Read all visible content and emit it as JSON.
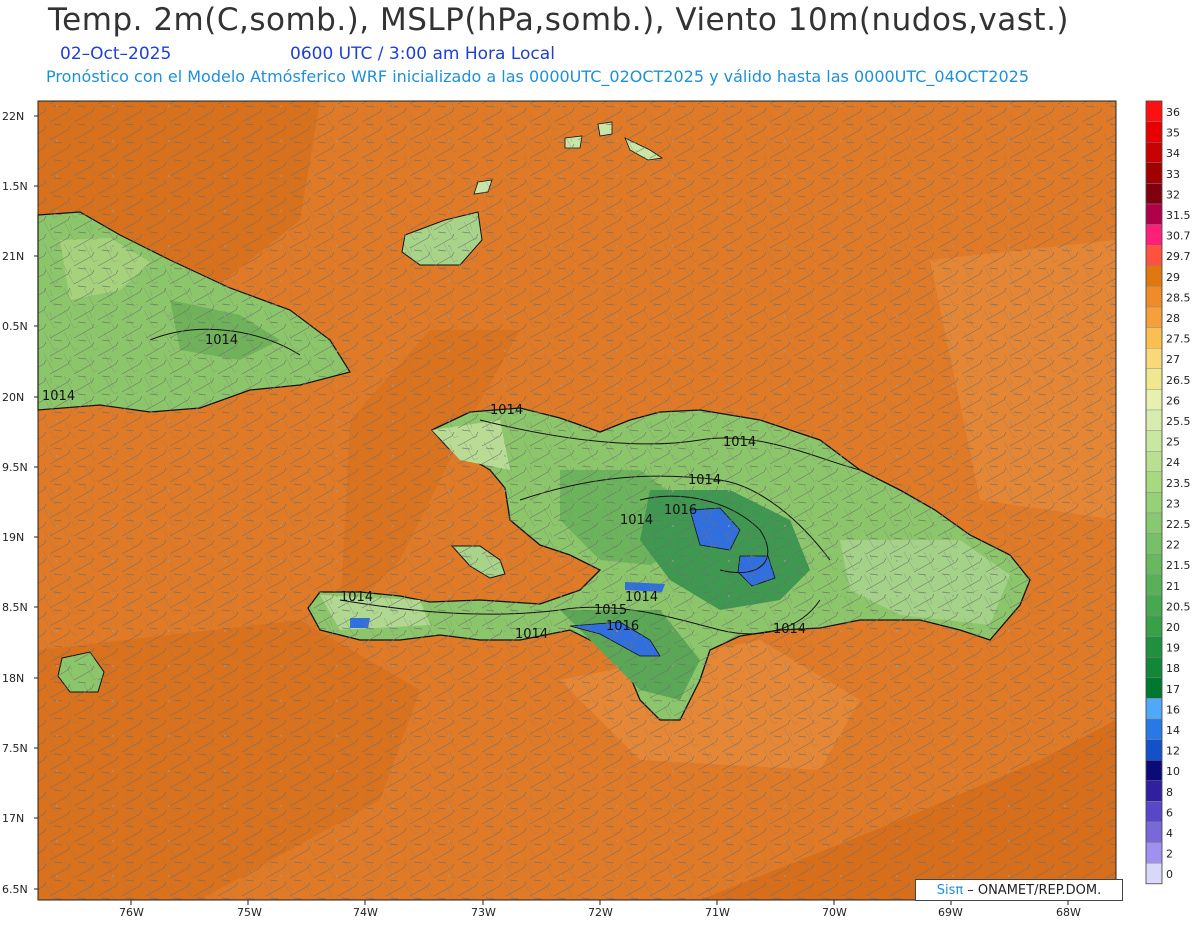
{
  "title": "Temp. 2m(C,somb.), MSLP(hPa,somb.), Viento 10m(nudos,vast.)",
  "date": "02–Oct–2025",
  "time": "0600 UTC / 3:00 am Hora Local",
  "subtitle": "Pronóstico con el Modelo Atmósferico WRF inicializado a las 0000UTC_02OCT2025 y válido hasta las  0000UTC_04OCT2025",
  "credit": {
    "brand": "Sisπ",
    "text": "– ONAMET/REP.DOM."
  },
  "lat_labels": [
    "22N",
    "1.5N",
    "21N",
    "0.5N",
    "20N",
    "9.5N",
    "19N",
    "8.5N",
    "18N",
    "7.5N",
    "17N",
    "6.5N"
  ],
  "lon_labels": [
    "76W",
    "75W",
    "74W",
    "73W",
    "72W",
    "71W",
    "70W",
    "69W",
    "68W"
  ],
  "isobar_labels": [
    "1014",
    "1014",
    "1014",
    "1014",
    "1014",
    "1014",
    "1016",
    "1014",
    "1015",
    "1014",
    "1016",
    "1014",
    "1014"
  ],
  "colorbar": {
    "values": [
      "36",
      "35",
      "34",
      "33",
      "32",
      "31.5",
      "30.7",
      "29.7",
      "29",
      "28.5",
      "28",
      "27.5",
      "27",
      "26.5",
      "26",
      "25.5",
      "25",
      "24",
      "23.5",
      "23",
      "22.5",
      "22",
      "21.5",
      "21",
      "20.5",
      "20",
      "19",
      "18",
      "17",
      "16",
      "14",
      "12",
      "10",
      "8",
      "6",
      "4",
      "2",
      "0"
    ],
    "colors": [
      "#ff1010",
      "#e60000",
      "#c80000",
      "#a00000",
      "#800010",
      "#b0004a",
      "#ff1f78",
      "#ff5040",
      "#e07810",
      "#f08c28",
      "#f5a03c",
      "#f8c050",
      "#f8d878",
      "#f0e890",
      "#e8f0b0",
      "#d8ecb0",
      "#c8e8a0",
      "#b8e090",
      "#a8d880",
      "#98d078",
      "#88c870",
      "#78c068",
      "#68b860",
      "#58b058",
      "#48a850",
      "#38a048",
      "#209040",
      "#108838",
      "#007830",
      "#50a8f8",
      "#2878e8",
      "#1450c8",
      "#0a0a78",
      "#3020a0",
      "#5848c8",
      "#7868d8",
      "#a090f0",
      "#d8d8f8"
    ]
  },
  "colors": {
    "ocean": "#e07a26",
    "ocean_dark": "#d06a14",
    "land": "#8cc66a",
    "high": "#2f8a4a",
    "cold": "#2f6fe0"
  }
}
